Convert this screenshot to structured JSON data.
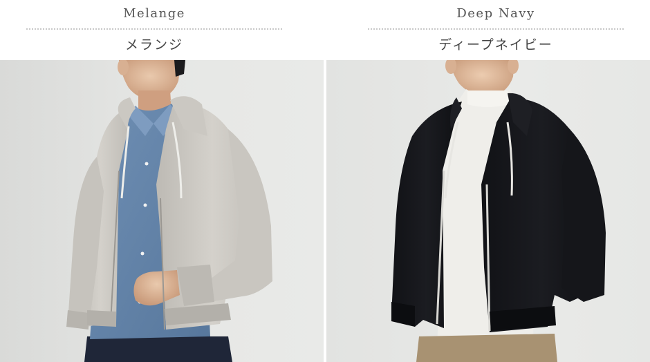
{
  "colors": {
    "left": {
      "name_en": "Melange",
      "name_jp": "メランジ",
      "swatch": "#cfccc6"
    },
    "right": {
      "name_en": "Deep Navy",
      "name_jp": "ディープネイビー",
      "swatch": "#15161a"
    }
  },
  "icons": [
    "model-in-melange-zip-hoodie",
    "model-in-deep-navy-zip-hoodie"
  ]
}
